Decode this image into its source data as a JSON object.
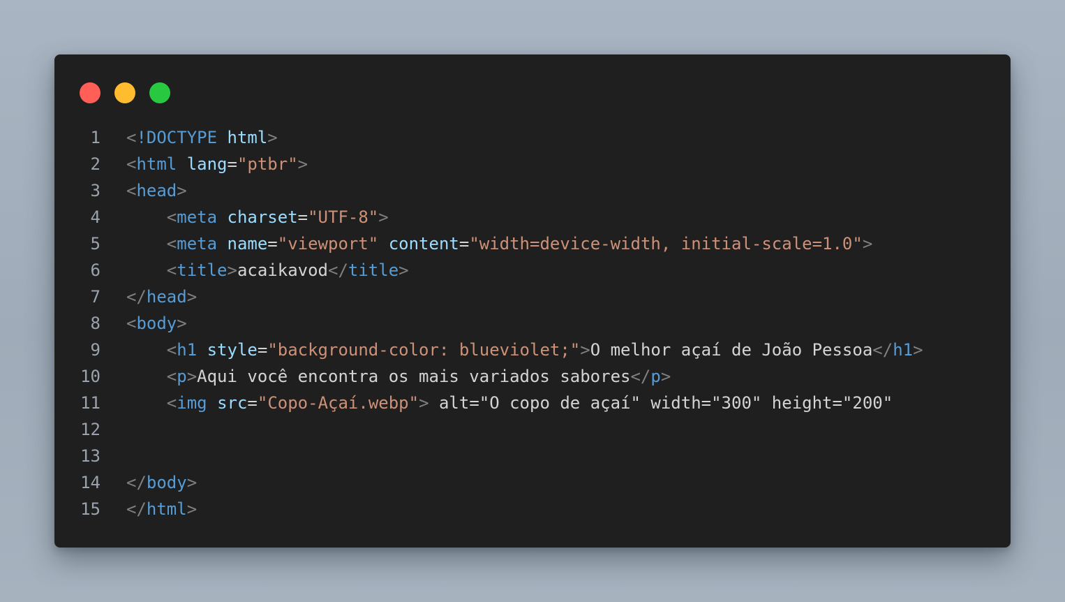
{
  "colors": {
    "page_background": "#a9b5c2",
    "window_background": "#1f1f1f",
    "line_number": "#9aa3ad",
    "punctuation": "#808080",
    "tag": "#569cd6",
    "attribute": "#9cdcfe",
    "string": "#ce9178",
    "text": "#d4d4d4"
  },
  "window_controls": [
    {
      "name": "close-dot",
      "color": "#ff5f57"
    },
    {
      "name": "minimize-dot",
      "color": "#febc2e"
    },
    {
      "name": "maximize-dot",
      "color": "#28c840"
    }
  ],
  "lines": [
    {
      "num": "1",
      "tokens": [
        {
          "t": "<",
          "c": "punct"
        },
        {
          "t": "!DOCTYPE",
          "c": "tag"
        },
        {
          "t": " ",
          "c": "txt"
        },
        {
          "t": "html",
          "c": "attr"
        },
        {
          "t": ">",
          "c": "punct"
        }
      ]
    },
    {
      "num": "2",
      "tokens": [
        {
          "t": "<",
          "c": "punct"
        },
        {
          "t": "html",
          "c": "tag"
        },
        {
          "t": " ",
          "c": "txt"
        },
        {
          "t": "lang",
          "c": "attr"
        },
        {
          "t": "=",
          "c": "txt"
        },
        {
          "t": "\"ptbr\"",
          "c": "str"
        },
        {
          "t": ">",
          "c": "punct"
        }
      ]
    },
    {
      "num": "3",
      "tokens": [
        {
          "t": "<",
          "c": "punct"
        },
        {
          "t": "head",
          "c": "tag"
        },
        {
          "t": ">",
          "c": "punct"
        }
      ]
    },
    {
      "num": "4",
      "tokens": [
        {
          "t": "    ",
          "c": "txt"
        },
        {
          "t": "<",
          "c": "punct"
        },
        {
          "t": "meta",
          "c": "tag"
        },
        {
          "t": " ",
          "c": "txt"
        },
        {
          "t": "charset",
          "c": "attr"
        },
        {
          "t": "=",
          "c": "txt"
        },
        {
          "t": "\"UTF-8\"",
          "c": "str"
        },
        {
          "t": ">",
          "c": "punct"
        }
      ]
    },
    {
      "num": "5",
      "tokens": [
        {
          "t": "    ",
          "c": "txt"
        },
        {
          "t": "<",
          "c": "punct"
        },
        {
          "t": "meta",
          "c": "tag"
        },
        {
          "t": " ",
          "c": "txt"
        },
        {
          "t": "name",
          "c": "attr"
        },
        {
          "t": "=",
          "c": "txt"
        },
        {
          "t": "\"viewport\"",
          "c": "str"
        },
        {
          "t": " ",
          "c": "txt"
        },
        {
          "t": "content",
          "c": "attr"
        },
        {
          "t": "=",
          "c": "txt"
        },
        {
          "t": "\"width=device-width, initial-scale=1.0\"",
          "c": "str"
        },
        {
          "t": ">",
          "c": "punct"
        }
      ]
    },
    {
      "num": "6",
      "tokens": [
        {
          "t": "    ",
          "c": "txt"
        },
        {
          "t": "<",
          "c": "punct"
        },
        {
          "t": "title",
          "c": "tag"
        },
        {
          "t": ">",
          "c": "punct"
        },
        {
          "t": "acaikavod",
          "c": "txt"
        },
        {
          "t": "</",
          "c": "punct"
        },
        {
          "t": "title",
          "c": "tag"
        },
        {
          "t": ">",
          "c": "punct"
        }
      ]
    },
    {
      "num": "7",
      "tokens": [
        {
          "t": "</",
          "c": "punct"
        },
        {
          "t": "head",
          "c": "tag"
        },
        {
          "t": ">",
          "c": "punct"
        }
      ]
    },
    {
      "num": "8",
      "tokens": [
        {
          "t": "<",
          "c": "punct"
        },
        {
          "t": "body",
          "c": "tag"
        },
        {
          "t": ">",
          "c": "punct"
        }
      ]
    },
    {
      "num": "9",
      "tokens": [
        {
          "t": "    ",
          "c": "txt"
        },
        {
          "t": "<",
          "c": "punct"
        },
        {
          "t": "h1",
          "c": "tag"
        },
        {
          "t": " ",
          "c": "txt"
        },
        {
          "t": "style",
          "c": "attr"
        },
        {
          "t": "=",
          "c": "txt"
        },
        {
          "t": "\"background-color: blueviolet;\"",
          "c": "str"
        },
        {
          "t": ">",
          "c": "punct"
        },
        {
          "t": "O melhor açaí de João Pessoa",
          "c": "txt"
        },
        {
          "t": "</",
          "c": "punct"
        },
        {
          "t": "h1",
          "c": "tag"
        },
        {
          "t": ">",
          "c": "punct"
        }
      ]
    },
    {
      "num": "10",
      "tokens": [
        {
          "t": "    ",
          "c": "txt"
        },
        {
          "t": "<",
          "c": "punct"
        },
        {
          "t": "p",
          "c": "tag"
        },
        {
          "t": ">",
          "c": "punct"
        },
        {
          "t": "Aqui você encontra os mais variados sabores",
          "c": "txt"
        },
        {
          "t": "</",
          "c": "punct"
        },
        {
          "t": "p",
          "c": "tag"
        },
        {
          "t": ">",
          "c": "punct"
        }
      ]
    },
    {
      "num": "11",
      "tokens": [
        {
          "t": "    ",
          "c": "txt"
        },
        {
          "t": "<",
          "c": "punct"
        },
        {
          "t": "img",
          "c": "tag"
        },
        {
          "t": " ",
          "c": "txt"
        },
        {
          "t": "src",
          "c": "attr"
        },
        {
          "t": "=",
          "c": "txt"
        },
        {
          "t": "\"Copo-Açaí.webp\"",
          "c": "str"
        },
        {
          "t": ">",
          "c": "punct"
        },
        {
          "t": " alt=\"O copo de açaí\" width=\"300\" height=\"200\"",
          "c": "txt"
        }
      ]
    },
    {
      "num": "12",
      "tokens": []
    },
    {
      "num": "13",
      "tokens": []
    },
    {
      "num": "14",
      "tokens": [
        {
          "t": "</",
          "c": "punct"
        },
        {
          "t": "body",
          "c": "tag"
        },
        {
          "t": ">",
          "c": "punct"
        }
      ]
    },
    {
      "num": "15",
      "tokens": [
        {
          "t": "</",
          "c": "punct"
        },
        {
          "t": "html",
          "c": "tag"
        },
        {
          "t": ">",
          "c": "punct"
        }
      ]
    }
  ]
}
